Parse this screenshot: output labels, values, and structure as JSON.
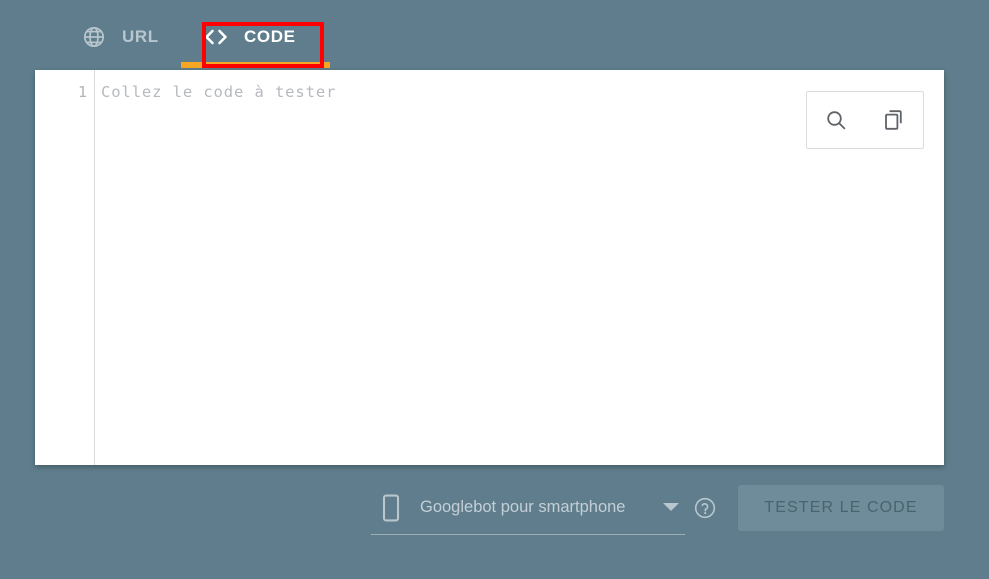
{
  "app": {
    "background_color": "#5f7d8c"
  },
  "tabs": {
    "active_index": 1,
    "items": [
      {
        "label": "URL",
        "icon": "globe-icon",
        "active": false
      },
      {
        "label": "CODE",
        "icon": "code-brackets-icon",
        "active": true
      }
    ],
    "active_underline_color": "#f5a623",
    "highlight_color": "#ff0000"
  },
  "editor": {
    "line_number": "1",
    "placeholder": "Collez le code à tester",
    "tools": [
      {
        "name": "search-icon",
        "label": "Rechercher"
      },
      {
        "name": "copy-icon",
        "label": "Copier"
      }
    ]
  },
  "bottom_bar": {
    "user_agent": {
      "icon": "smartphone-icon",
      "value": "Googlebot pour smartphone",
      "caret": "chevron-down-icon"
    },
    "help": {
      "icon": "help-circle-icon",
      "label": "?"
    },
    "test_button": {
      "label": "TESTER LE CODE",
      "enabled": false,
      "background_color": "#6f8c9a",
      "text_color": "#4a6370"
    }
  }
}
